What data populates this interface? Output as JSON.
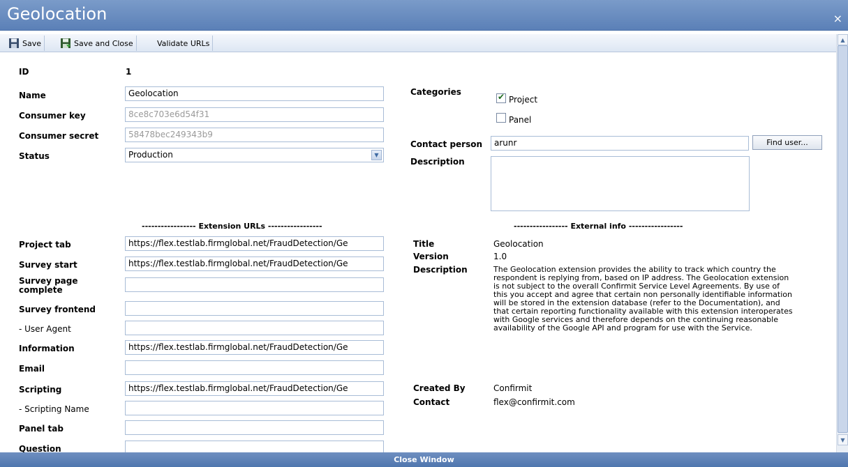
{
  "window": {
    "title": "Geolocation",
    "close_label": "×"
  },
  "toolbar": {
    "save": "Save",
    "save_close": "Save and Close",
    "validate": "Validate URLs"
  },
  "left": {
    "id_label": "ID",
    "id_value": "1",
    "name_label": "Name",
    "name_value": "Geolocation",
    "consumer_key_label": "Consumer key",
    "consumer_key_value": "8ce8c703e6d54f31",
    "consumer_secret_label": "Consumer secret",
    "consumer_secret_value": "58478bec249343b9",
    "status_label": "Status",
    "status_value": "Production"
  },
  "right": {
    "categories_label": "Categories",
    "categories": [
      {
        "label": "Project",
        "checked": true
      },
      {
        "label": "Panel",
        "checked": false
      }
    ],
    "contact_person_label": "Contact person",
    "contact_person_value": "arunr",
    "find_user": "Find user...",
    "description_label": "Description"
  },
  "extension": {
    "header": "----------------- Extension URLs -----------------",
    "rows": [
      {
        "label": "Project tab",
        "value": "https://flex.testlab.firmglobal.net/FraudDetection/Ge"
      },
      {
        "label": "Survey start",
        "value": "https://flex.testlab.firmglobal.net/FraudDetection/Ge"
      },
      {
        "label": "Survey page complete",
        "value": ""
      },
      {
        "label": "Survey frontend",
        "value": ""
      },
      {
        "label": "- User Agent",
        "value": ""
      },
      {
        "label": "Information",
        "value": "https://flex.testlab.firmglobal.net/FraudDetection/Ge"
      },
      {
        "label": "Email",
        "value": ""
      },
      {
        "label": "Scripting",
        "value": "https://flex.testlab.firmglobal.net/FraudDetection/Ge"
      },
      {
        "label": "- Scripting Name",
        "value": ""
      },
      {
        "label": "Panel tab",
        "value": ""
      },
      {
        "label": "Question",
        "value": ""
      }
    ]
  },
  "external": {
    "header": "----------------- External info -----------------",
    "title_label": "Title",
    "title_value": "Geolocation",
    "version_label": "Version",
    "version_value": "1.0",
    "description_label": "Description",
    "description_value": "The Geolocation extension provides the ability to track which country the respondent is replying from, based on IP address. The Geolocation extension is not subject to the overall Confirmit Service Level Agreements. By use of this you accept and agree that certain non personally identifiable information will be stored in the extension database (refer to the Documentation), and that certain reporting functionality available with this extension interoperates with Google services and therefore depends on the continuing reasonable availability of the Google API and program for use with the Service.",
    "created_by_label": "Created By",
    "created_by_value": "Confirmit",
    "contact_label": "Contact",
    "contact_value": "flex@confirmit.com"
  },
  "footer": {
    "close_window": "Close Window"
  }
}
